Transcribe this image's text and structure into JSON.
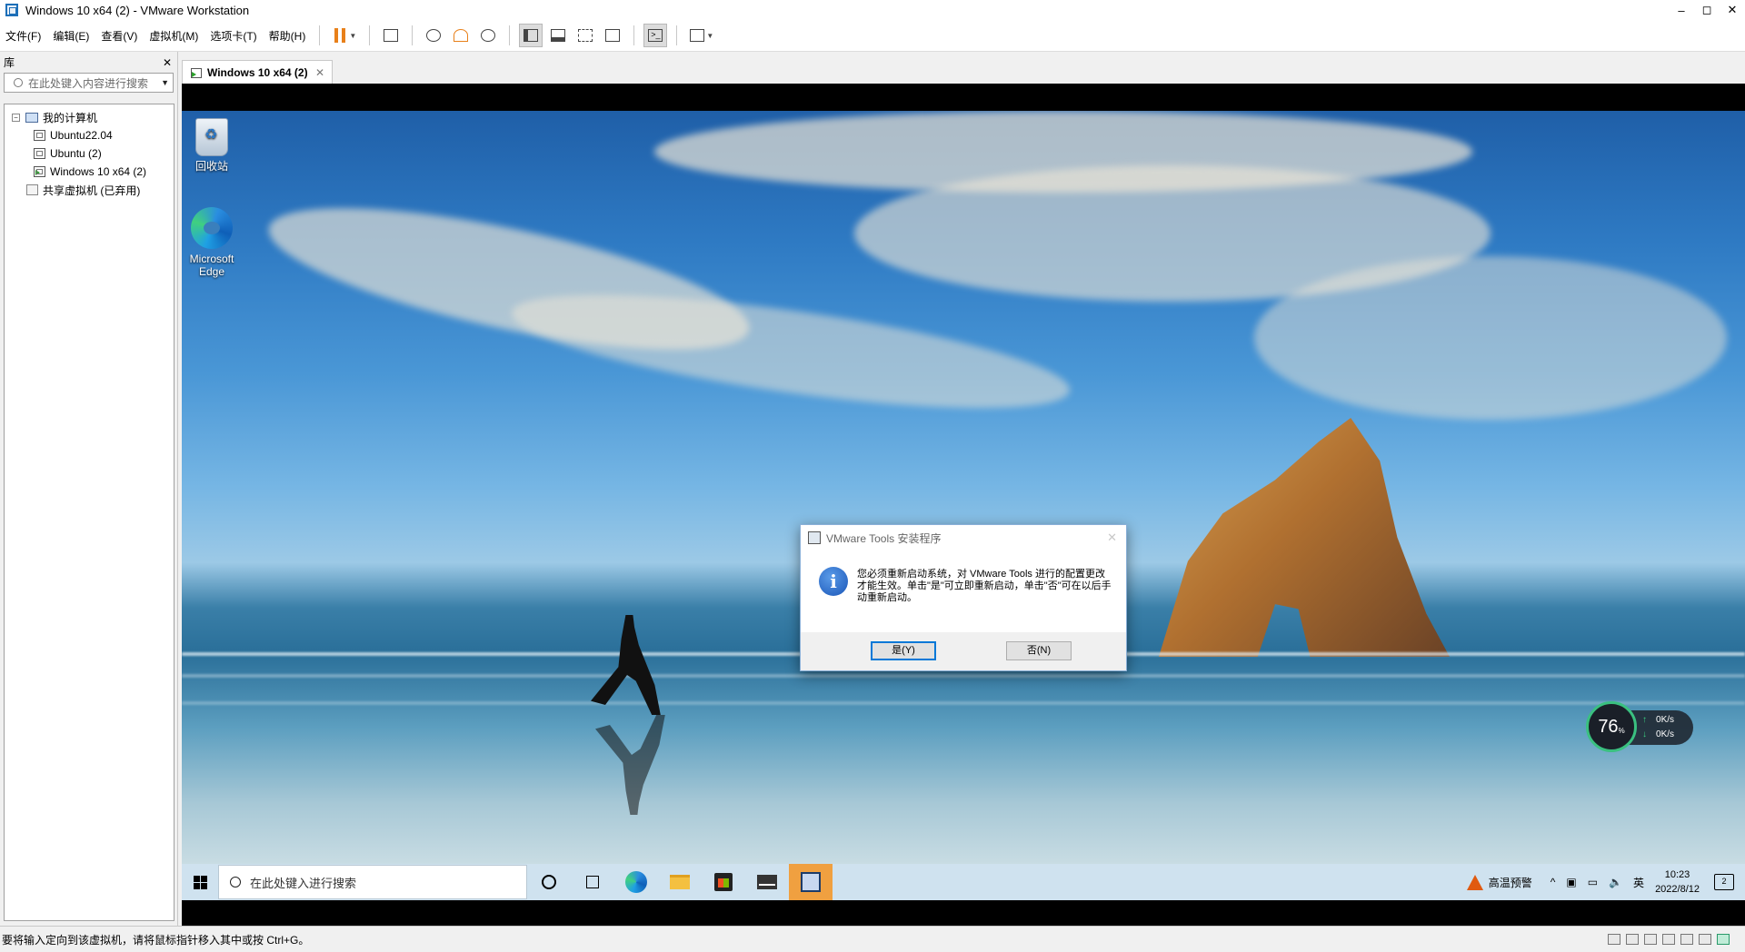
{
  "window": {
    "title": "Windows 10 x64 (2) - VMware Workstation",
    "min_glyph": "–",
    "max_glyph": "◻",
    "close_glyph": "✕"
  },
  "menu": {
    "items": [
      "文件(F)",
      "编辑(E)",
      "查看(V)",
      "虚拟机(M)",
      "选项卡(T)",
      "帮助(H)"
    ]
  },
  "toolbar": {
    "icons": [
      "pause-icon",
      "send-ctrl-alt-del-icon",
      "snapshot-icon",
      "revert-snapshot-icon",
      "manage-snapshots-icon",
      "library-view-icon",
      "thumbnail-bar-icon",
      "full-screen-icon",
      "unity-icon",
      "console-view-icon",
      "stretch-icon"
    ],
    "accent": "#e8801a"
  },
  "library": {
    "header": "库",
    "close_glyph": "✕",
    "search_placeholder": "在此处键入内容进行搜索",
    "tree": {
      "root": "我的计算机",
      "vms": [
        "Ubuntu22.04",
        "Ubuntu (2)",
        "Windows 10 x64 (2)"
      ],
      "shared": "共享虚拟机 (已弃用)"
    }
  },
  "tab": {
    "label": "Windows 10 x64 (2)",
    "close_glyph": "✕"
  },
  "desktop": {
    "icons": [
      {
        "label": "回收站"
      },
      {
        "label": "Microsoft Edge"
      }
    ]
  },
  "dialog": {
    "title": "VMware Tools 安装程序",
    "close_glyph": "✕",
    "info_glyph": "i",
    "message": "您必须重新启动系统，对 VMware Tools 进行的配置更改才能生效。单击\"是\"可立即重新启动，单击\"否\"可在以后手动重新启动。",
    "yes_label": "是(Y)",
    "no_label": "否(N)"
  },
  "network_widget": {
    "percent": "76",
    "percent_unit": "%",
    "upload": "0",
    "download": "0",
    "rate_unit": "K/s",
    "up_arrow": "↑",
    "down_arrow": "↓",
    "ring_color": "#3ac080"
  },
  "taskbar": {
    "search_placeholder": "在此处键入进行搜索",
    "alert_text": "高温预警",
    "tray_chevron": "^",
    "ime": "英",
    "time": "10:23",
    "date": "2022/8/12",
    "notification_count": "2",
    "active_app_color": "#f0a040"
  },
  "statusbar": {
    "message": "要将输入定向到该虚拟机，请将鼠标指针移入其中或按 Ctrl+G。"
  }
}
